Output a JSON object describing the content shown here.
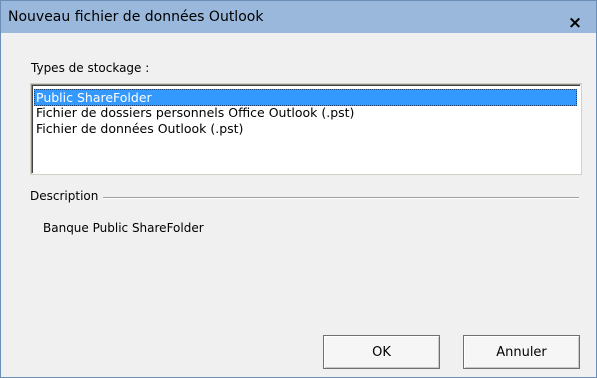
{
  "window": {
    "title": "Nouveau fichier de données Outlook",
    "close_glyph": "×"
  },
  "storage": {
    "label": "Types de stockage :",
    "items": [
      {
        "label": "Public ShareFolder",
        "selected": true
      },
      {
        "label": "Fichier de dossiers personnels Office Outlook (.pst)",
        "selected": false
      },
      {
        "label": "Fichier de données Outlook (.pst)",
        "selected": false
      }
    ]
  },
  "description": {
    "label": "Description",
    "text": "Banque Public ShareFolder"
  },
  "buttons": {
    "ok": "OK",
    "cancel": "Annuler"
  },
  "colors": {
    "titlebar": "#9ab8dc",
    "selection": "#3399ff",
    "dialog_bg": "#f0f0f0"
  }
}
